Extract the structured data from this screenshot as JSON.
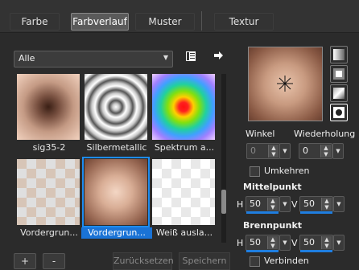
{
  "tabs": [
    {
      "label": "Farbe"
    },
    {
      "label": "Farbverlauf"
    },
    {
      "label": "Muster"
    },
    {
      "label": "Textur"
    }
  ],
  "category": {
    "selected": "Alle"
  },
  "gallery": [
    {
      "label": "sig35-2"
    },
    {
      "label": "Silbermetallic"
    },
    {
      "label": "Spektrum a..."
    },
    {
      "label": "Vordergrun..."
    },
    {
      "label": "Vordergrun..."
    },
    {
      "label": "Weiß ausla..."
    }
  ],
  "bottom": {
    "add": "+",
    "remove": "-",
    "reset": "Zurücksetzen",
    "save": "Speichern"
  },
  "settings": {
    "winkel_label": "Winkel",
    "winkel_value": "0",
    "wiederholung_label": "Wiederholung",
    "wiederholung_value": "0",
    "umkehren_label": "Umkehren",
    "mittelpunkt_label": "Mittelpunkt",
    "mittel_h_label": "H",
    "mittel_h_value": "50",
    "mittel_v_label": "V",
    "mittel_v_value": "50",
    "brennpunkt_label": "Brennpunkt",
    "brenn_h_label": "H",
    "brenn_h_value": "50",
    "brenn_v_label": "V",
    "brenn_v_value": "50",
    "verbinden_label": "Verbinden"
  },
  "colors": {
    "accent": "#1e8cf0",
    "selection": "#1a73d6",
    "background": "#2b2b2b"
  }
}
